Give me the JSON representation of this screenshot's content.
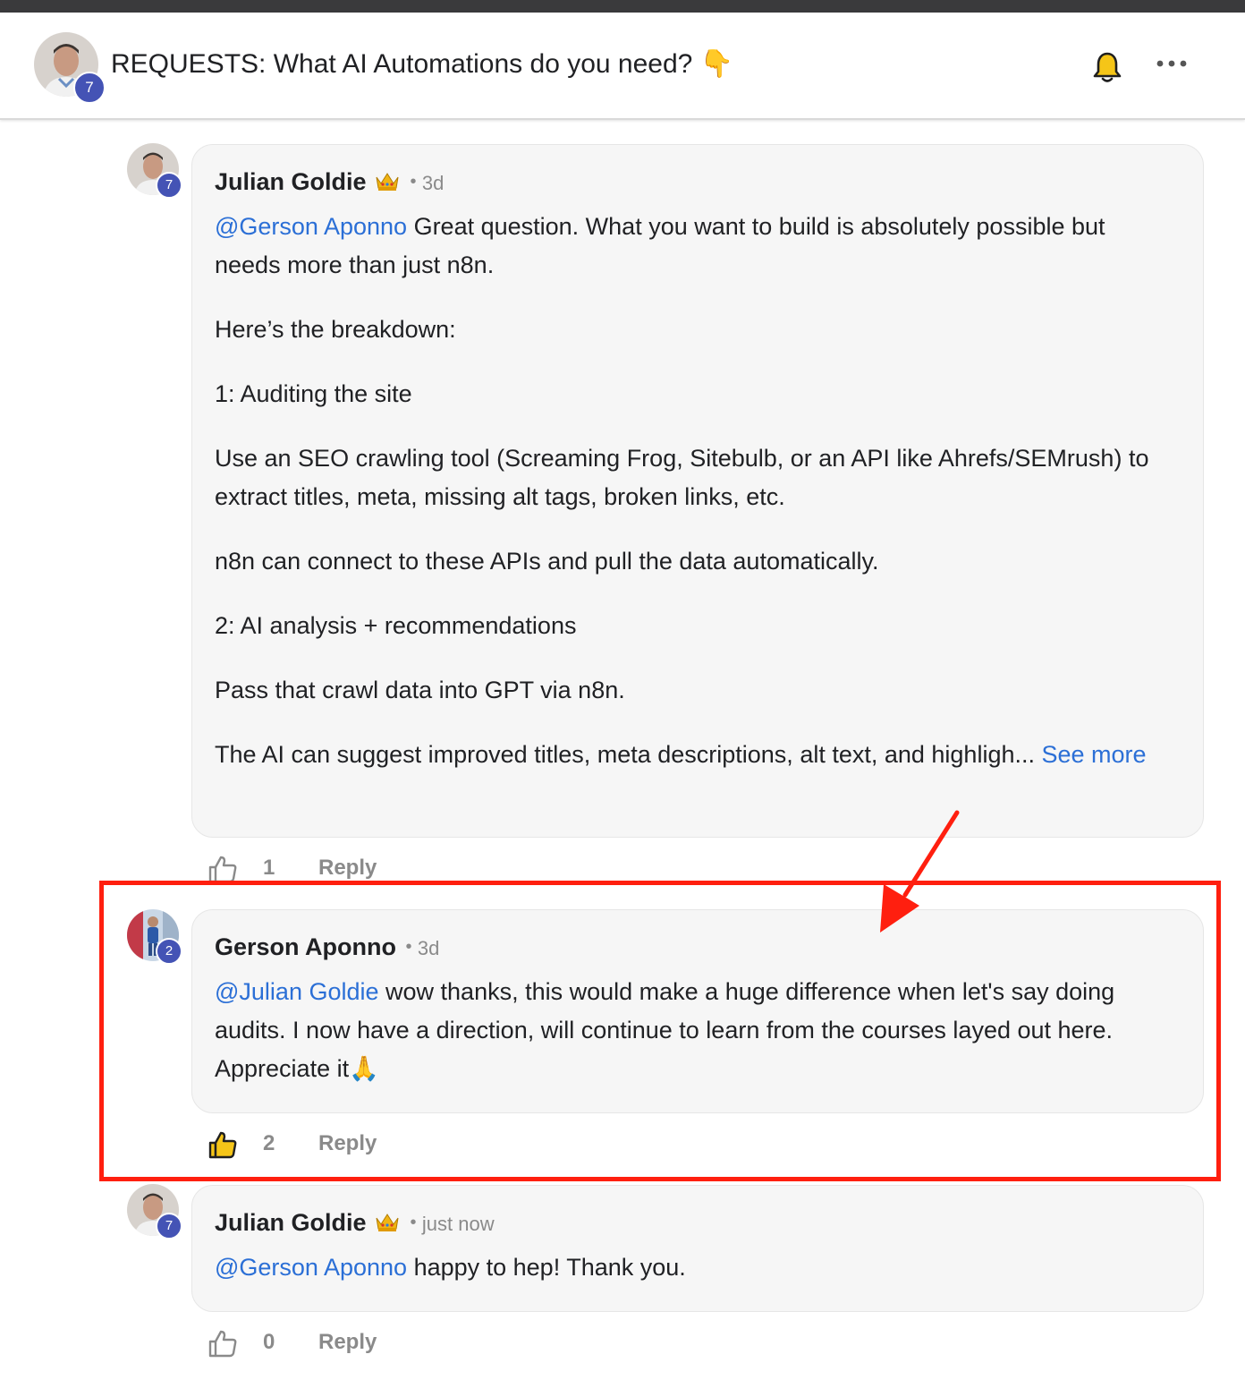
{
  "header": {
    "title": "REQUESTS: What AI Automations do you need? 👇",
    "author_level": "7"
  },
  "comments": [
    {
      "author": "Julian Goldie",
      "level": "7",
      "time": "3d",
      "mention": "@Gerson Aponno",
      "first_text": " Great question. What you want to build is absolutely possible but needs more than just n8n.",
      "paragraphs": [
        "Here’s the breakdown:",
        "1: Auditing the site",
        "Use an SEO crawling tool (Screaming Frog, Sitebulb, or an API like Ahrefs/SEMrush) to extract titles, meta, missing alt tags, broken links, etc.",
        "n8n can connect to these APIs and pull the data automatically.",
        "2: AI analysis + recommendations",
        "Pass that crawl data into GPT via n8n."
      ],
      "last_text": "The AI can suggest improved titles, meta descriptions, alt text, and highligh... ",
      "see_more": "See more",
      "likes": "1",
      "reply_label": "Reply"
    },
    {
      "author": "Gerson Aponno",
      "level": "2",
      "time": "3d",
      "mention": "@Julian Goldie",
      "first_text": " wow thanks, this would make a huge difference when let's say doing audits. I now have a direction, will continue to learn from the courses layed out here. Appreciate it🙏",
      "likes": "2",
      "liked": true,
      "reply_label": "Reply"
    },
    {
      "author": "Julian Goldie",
      "level": "7",
      "time": "just now",
      "mention": "@Gerson Aponno",
      "first_text": " happy to hep! Thank you.",
      "likes": "0",
      "reply_label": "Reply"
    }
  ],
  "icons": {
    "bell": "bell-icon",
    "more": "more-horizontal-icon",
    "crown": "crown-icon",
    "like": "thumbs-up-icon"
  },
  "colors": {
    "link": "#2b6fd6",
    "badge": "#4453b5",
    "highlight": "#ff1f0f",
    "liked": "#f5c518"
  }
}
